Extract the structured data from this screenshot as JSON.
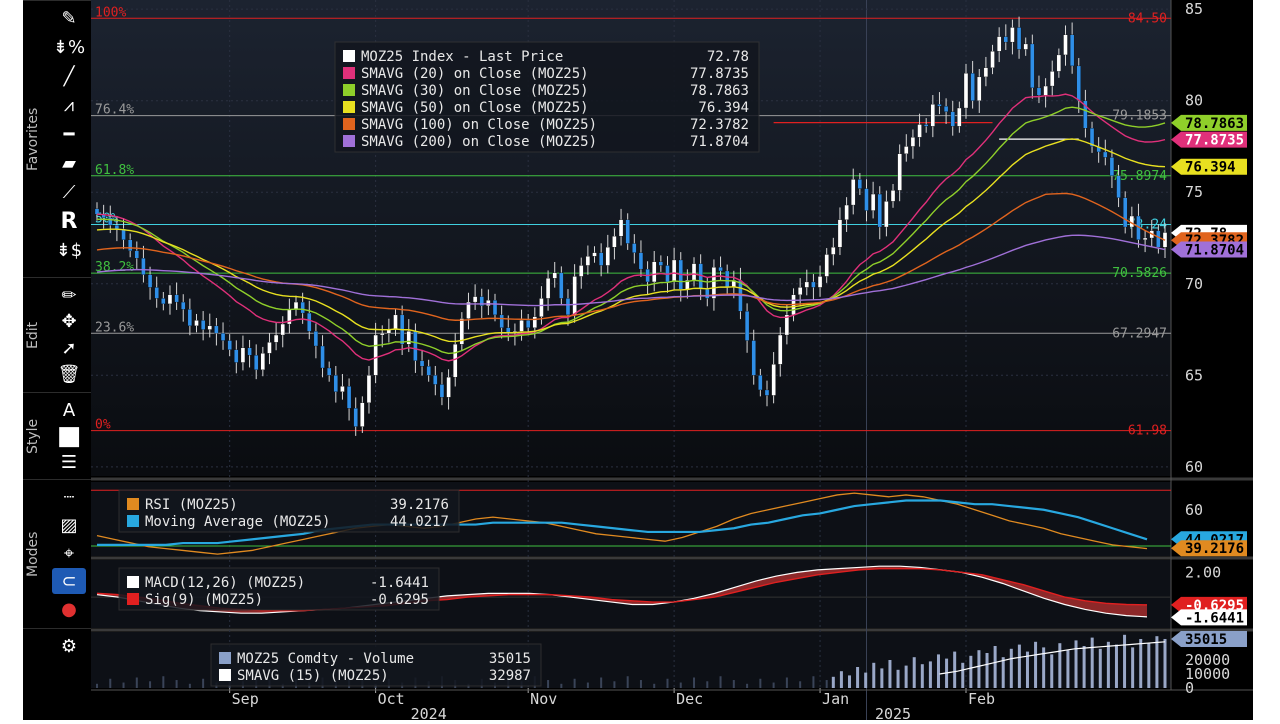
{
  "toolbar": {
    "groups": [
      {
        "label": "Favorites",
        "icons": [
          "pencil-icon",
          "percent-ruler-icon",
          "trend-line-icon",
          "multi-line-icon",
          "horizontal-line-icon",
          "channel-icon",
          "ray-icon",
          "r-icon",
          "dollar-ruler-icon"
        ]
      },
      {
        "label": "Edit",
        "icons": [
          "pen-icon",
          "move-icon",
          "pointer-icon",
          "trash-icon"
        ]
      },
      {
        "label": "Style",
        "icons": [
          "font-icon",
          "color-box-icon",
          "line-style-icon"
        ]
      },
      {
        "label": "Modes",
        "icons": [
          "dotted-line-icon",
          "hatch-icon",
          "crosshair-icon",
          "magnet-icon",
          "palette-icon"
        ]
      },
      {
        "label": "",
        "icons": [
          "gear-icon"
        ]
      }
    ],
    "r_letter": "R"
  },
  "colors": {
    "background": "#000000",
    "up_candle": "#ffffff",
    "down_candle": "#2f8fe8",
    "sma20": "#e0307a",
    "sma30": "#8fcf2a",
    "sma50": "#e8e020",
    "sma100": "#e0641e",
    "sma200": "#a070d8",
    "rsi": "#e08a20",
    "rsi_ma": "#28a8e0",
    "macd": "#ffffff",
    "signal": "#e02020",
    "fib_red": "#e02020",
    "fib_green": "#40c040",
    "fib_cyan": "#40d0e0",
    "fib_gray": "#9a9a9a"
  },
  "main_legend": [
    {
      "label": "MOZ25 Index - Last Price",
      "value": "72.78",
      "color": "#ffffff"
    },
    {
      "label": "SMAVG (20)  on Close (MOZ25)",
      "value": "77.8735",
      "color": "#e0307a"
    },
    {
      "label": "SMAVG (30)  on Close (MOZ25)",
      "value": "78.7863",
      "color": "#8fcf2a"
    },
    {
      "label": "SMAVG (50)  on Close (MOZ25)",
      "value": "76.394",
      "color": "#e8e020"
    },
    {
      "label": "SMAVG (100)  on Close (MOZ25)",
      "value": "72.3782",
      "color": "#e0641e"
    },
    {
      "label": "SMAVG (200)  on Close (MOZ25)",
      "value": "71.8704",
      "color": "#a070d8"
    }
  ],
  "rsi_legend": [
    {
      "label": "RSI (MOZ25)",
      "value": "39.2176",
      "color": "#e08a20"
    },
    {
      "label": "Moving Average (MOZ25)",
      "value": "44.0217",
      "color": "#28a8e0"
    }
  ],
  "macd_legend": [
    {
      "label": "MACD(12,26) (MOZ25)",
      "value": "-1.6441",
      "color": "#ffffff"
    },
    {
      "label": "Sig(9) (MOZ25)",
      "value": "-0.6295",
      "color": "#e02020"
    }
  ],
  "volume_legend": [
    {
      "label": "MOZ25 Comdty - Volume",
      "value": "35015",
      "color": "#8aa0c8"
    },
    {
      "label": "SMAVG (15) (MOZ25)",
      "value": "32987",
      "color": "#ffffff"
    }
  ],
  "fib_levels": [
    {
      "pct_label": "100%",
      "value": 84.5,
      "value_label": "84.50",
      "color": "#e02020"
    },
    {
      "pct_label": "76.4%",
      "value": 79.1853,
      "value_label": "79.1853",
      "color": "#9a9a9a"
    },
    {
      "pct_label": "61.8%",
      "value": 75.8974,
      "value_label": "75.8974",
      "color": "#40c040"
    },
    {
      "pct_label": "50%",
      "value": 73.24,
      "value_label": "73.24",
      "color": "#40d0e0"
    },
    {
      "pct_label": "38.2%",
      "value": 70.5826,
      "value_label": "70.5826",
      "color": "#40c040"
    },
    {
      "pct_label": "23.6%",
      "value": 67.2947,
      "value_label": "67.2947",
      "color": "#9a9a9a"
    },
    {
      "pct_label": "0%",
      "value": 61.98,
      "value_label": "61.98",
      "color": "#e02020"
    }
  ],
  "right_tags": {
    "main": [
      {
        "text": "78.7863",
        "value": 78.7863,
        "bg": "#8fcf2a",
        "fg": "#000000"
      },
      {
        "text": "77.8735",
        "value": 77.8735,
        "bg": "#e0307a",
        "fg": "#ffffff"
      },
      {
        "text": "76.394",
        "value": 76.394,
        "bg": "#e8e020",
        "fg": "#000000"
      },
      {
        "text": "72.78",
        "value": 72.78,
        "bg": "#ffffff",
        "fg": "#000000"
      },
      {
        "text": "72.3782",
        "value": 72.3782,
        "bg": "#e0641e",
        "fg": "#000000"
      },
      {
        "text": "71.8704",
        "value": 71.8704,
        "bg": "#a070d8",
        "fg": "#000000"
      }
    ],
    "rsi": [
      {
        "text": "44.0217",
        "value": 44.0217,
        "bg": "#28a8e0",
        "fg": "#000000"
      },
      {
        "text": "39.2176",
        "value": 39.2176,
        "bg": "#e08a20",
        "fg": "#000000"
      }
    ],
    "macd": [
      {
        "text": "-0.6295",
        "value": -0.6295,
        "bg": "#e02020",
        "fg": "#ffffff"
      },
      {
        "text": "-1.6441",
        "value": -1.6441,
        "bg": "#ffffff",
        "fg": "#000000"
      }
    ],
    "volume": [
      {
        "text": "35015",
        "value": 35015,
        "bg": "#8aa0c8",
        "fg": "#000000"
      }
    ]
  },
  "chart_data": [
    {
      "type": "candlestick",
      "title": "",
      "ylim": [
        59.5,
        85.5
      ],
      "y_ticks": [
        60,
        65,
        70,
        75,
        80,
        85
      ],
      "x_ticks": [
        "Sep",
        "Oct",
        "Nov",
        "Dec",
        "Jan",
        "Feb"
      ],
      "x_tick_days": [
        20,
        42,
        65,
        87,
        109,
        131
      ],
      "year_labels": [
        {
          "text": "2024",
          "day": 50
        },
        {
          "text": "2025",
          "day": 120
        }
      ],
      "year_boundary_day": 116,
      "closes": [
        73.8,
        73.6,
        73.2,
        73.0,
        72.4,
        71.8,
        71.4,
        70.5,
        69.8,
        69.2,
        68.9,
        69.4,
        69.0,
        68.6,
        67.7,
        68.0,
        67.5,
        67.7,
        67.3,
        66.9,
        66.4,
        65.7,
        66.5,
        66.1,
        65.3,
        66.2,
        66.8,
        67.2,
        67.8,
        68.6,
        69.0,
        68.4,
        67.4,
        66.6,
        65.4,
        65.0,
        64.1,
        64.4,
        63.2,
        62.2,
        63.5,
        65.0,
        67.2,
        67.3,
        67.5,
        68.3,
        66.7,
        67.4,
        65.8,
        65.5,
        65.0,
        64.5,
        63.8,
        64.9,
        66.7,
        68.1,
        69.0,
        69.3,
        68.8,
        69.1,
        68.3,
        67.6,
        67.3,
        67.4,
        68.0,
        67.6,
        68.2,
        69.2,
        70.3,
        70.6,
        69.2,
        68.3,
        70.4,
        71.0,
        71.5,
        71.7,
        71.0,
        72.0,
        72.6,
        73.5,
        72.2,
        71.7,
        70.8,
        70.1,
        71.2,
        71.0,
        70.1,
        71.3,
        69.7,
        70.2,
        71.1,
        69.7,
        69.2,
        70.9,
        70.7,
        69.8,
        70.2,
        68.5,
        66.9,
        65.0,
        64.2,
        63.9,
        65.6,
        67.2,
        68.3,
        69.4,
        69.8,
        70.1,
        69.8,
        70.4,
        71.6,
        72.0,
        73.5,
        74.3,
        75.7,
        75.2,
        74.0,
        74.9,
        73.1,
        74.5,
        75.1,
        77.1,
        77.5,
        78.0,
        78.7,
        78.6,
        79.8,
        79.7,
        79.4,
        78.6,
        79.6,
        81.5,
        80.0,
        81.3,
        81.8,
        82.7,
        83.5,
        83.2,
        84.0,
        82.8,
        83.1,
        80.7,
        80.3,
        80.8,
        81.6,
        82.5,
        83.6,
        81.9,
        80.0,
        78.5,
        77.5,
        77.2,
        76.9,
        75.9,
        74.7,
        73.1,
        73.7,
        72.4,
        72.5,
        72.9,
        72.0,
        72.8
      ],
      "series": [
        {
          "name": "SMAVG (20)  on Close (MOZ25)",
          "last": 77.8735,
          "color": "#e0307a"
        },
        {
          "name": "SMAVG (30)  on Close (MOZ25)",
          "last": 78.7863,
          "color": "#8fcf2a"
        },
        {
          "name": "SMAVG (50)  on Close (MOZ25)",
          "last": 76.394,
          "color": "#e8e020"
        },
        {
          "name": "SMAVG (100)  on Close (MOZ25)",
          "last": 72.3782,
          "color": "#e0641e"
        },
        {
          "name": "SMAVG (200)  on Close (MOZ25)",
          "last": 71.8704,
          "color": "#a070d8"
        }
      ],
      "sma_windows": [
        20,
        30,
        50,
        100,
        200
      ],
      "sma_start": [
        73.8,
        73.5,
        72.9,
        71.8,
        70.6
      ],
      "sma_starts_smoothing": [
        0.09,
        0.065,
        0.045,
        0.025,
        0.012
      ],
      "ray_lines": [
        {
          "from_day": 102,
          "to_day": 135,
          "value": 78.8,
          "color": "#e02020"
        },
        {
          "from_day": 136,
          "to_day": 148,
          "value": 77.9,
          "color": "#ffffff"
        }
      ]
    },
    {
      "type": "line",
      "name": "RSI",
      "ylim": [
        35,
        75
      ],
      "y_ticks": [
        60
      ],
      "upper_band": 70,
      "lower_band": 30,
      "series": [
        {
          "name": "RSI (MOZ25)",
          "color": "#e08a20",
          "values": [
            46,
            44,
            42,
            40,
            39,
            38,
            37,
            36,
            37,
            38,
            40,
            42,
            44,
            46,
            48,
            50,
            51,
            52,
            51,
            50,
            51,
            53,
            55,
            56,
            55,
            54,
            53,
            51,
            49,
            47,
            46,
            45,
            44,
            43,
            45,
            48,
            51,
            55,
            58,
            60,
            62,
            64,
            66,
            68,
            69,
            68,
            67,
            68,
            67,
            65,
            63,
            60,
            57,
            54,
            52,
            50,
            47,
            45,
            43,
            41,
            40,
            39
          ]
        },
        {
          "name": "Moving Average (MOZ25)",
          "color": "#28a8e0",
          "values": [
            41,
            41,
            41,
            41,
            41,
            42,
            42,
            42,
            43,
            44,
            45,
            46,
            47,
            49,
            50,
            51,
            52,
            52,
            52,
            52,
            52,
            52,
            52,
            53,
            53,
            53,
            53,
            53,
            52,
            51,
            50,
            49,
            48,
            48,
            48,
            48,
            49,
            50,
            52,
            53,
            55,
            57,
            58,
            60,
            62,
            63,
            64,
            65,
            65,
            65,
            64,
            63,
            63,
            62,
            61,
            60,
            58,
            56,
            53,
            50,
            47,
            44
          ]
        }
      ]
    },
    {
      "type": "area",
      "name": "MACD",
      "ylim": [
        -2.5,
        3.0
      ],
      "y_ticks": [
        2.0
      ],
      "series": [
        {
          "name": "MACD(12,26) (MOZ25)",
          "color": "#ffffff",
          "values": [
            0.2,
            0.0,
            -0.3,
            -0.6,
            -0.9,
            -1.1,
            -1.2,
            -1.3,
            -1.3,
            -1.2,
            -1.1,
            -1.0,
            -0.9,
            -0.7,
            -0.5,
            -0.3,
            -0.1,
            0.1,
            0.2,
            0.3,
            0.3,
            0.3,
            0.2,
            0.0,
            -0.2,
            -0.4,
            -0.6,
            -0.6,
            -0.4,
            -0.1,
            0.3,
            0.8,
            1.3,
            1.7,
            2.0,
            2.2,
            2.3,
            2.4,
            2.5,
            2.5,
            2.4,
            2.2,
            2.0,
            1.6,
            1.1,
            0.5,
            -0.1,
            -0.6,
            -1.0,
            -1.3,
            -1.5,
            -1.6
          ]
        },
        {
          "name": "Sig(9) (MOZ25)",
          "color": "#e02020",
          "values": [
            0.3,
            0.2,
            0.0,
            -0.2,
            -0.5,
            -0.7,
            -0.9,
            -1.0,
            -1.1,
            -1.1,
            -1.1,
            -1.0,
            -0.9,
            -0.8,
            -0.7,
            -0.5,
            -0.3,
            -0.2,
            0.0,
            0.1,
            0.2,
            0.2,
            0.2,
            0.1,
            0.0,
            -0.2,
            -0.3,
            -0.4,
            -0.4,
            -0.2,
            0.0,
            0.4,
            0.8,
            1.2,
            1.5,
            1.8,
            2.0,
            2.2,
            2.3,
            2.3,
            2.3,
            2.2,
            2.0,
            1.8,
            1.4,
            1.0,
            0.5,
            0.0,
            -0.3,
            -0.5,
            -0.6,
            -0.63
          ]
        }
      ]
    },
    {
      "type": "bar",
      "name": "Volume",
      "ylim": [
        0,
        40000
      ],
      "y_ticks": [
        0,
        10000,
        20000
      ],
      "start_day": 111,
      "values": [
        8000,
        12000,
        9000,
        15000,
        11000,
        18000,
        14000,
        20000,
        13000,
        16000,
        22000,
        17000,
        19000,
        24000,
        21000,
        26000,
        18000,
        23000,
        27000,
        25000,
        30000,
        22000,
        28000,
        31000,
        26000,
        33000,
        29000,
        24000,
        32000,
        27000,
        34000,
        30000,
        36000,
        28000,
        33000,
        31000,
        38000,
        29000,
        35000,
        32000,
        37000,
        35015
      ],
      "sma": [
        10000,
        11000,
        12000,
        13500,
        15000,
        16500,
        18000,
        19500,
        21000,
        22000,
        23000,
        24000,
        25000,
        26000,
        27000,
        28000,
        28500,
        29000,
        29500,
        30000,
        30500,
        31000,
        31500,
        32000,
        32500,
        32987
      ]
    }
  ]
}
